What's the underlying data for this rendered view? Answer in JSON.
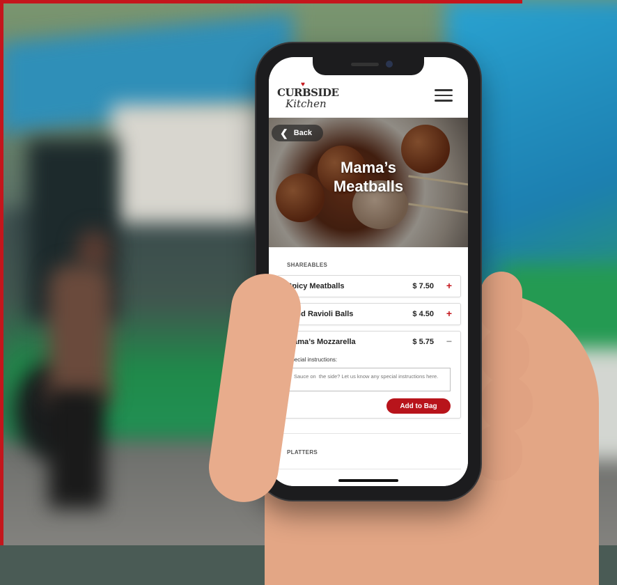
{
  "app": {
    "logo_top": "CURBSIDE",
    "logo_bottom": "Kitchen"
  },
  "header": {
    "back_label": "Back",
    "title_line1": "Mama’s",
    "title_line2": "Meatballs"
  },
  "sections": [
    {
      "label": "SHAREABLES",
      "items": [
        {
          "name": "Spicy Meatballs",
          "price": "$ 7.50",
          "toggle": "+"
        },
        {
          "name": "Fried Ravioli Balls",
          "price": "$ 4.50",
          "toggle": "+"
        },
        {
          "name": "Mama’s Mozzarella",
          "price": "$ 5.75",
          "toggle": "−",
          "instructions_label": "Special instructions:",
          "instructions_placeholder": "Sauce on  the side? Let us know any special instructions here.",
          "add_label": "Add to Bag"
        }
      ]
    },
    {
      "label": "PLATTERS"
    }
  ],
  "colors": {
    "accent": "#c4161c",
    "button": "#b8141b"
  },
  "icons": [
    "heart-icon",
    "hamburger-menu-icon",
    "chevron-left-icon",
    "plus-icon",
    "minus-icon"
  ]
}
